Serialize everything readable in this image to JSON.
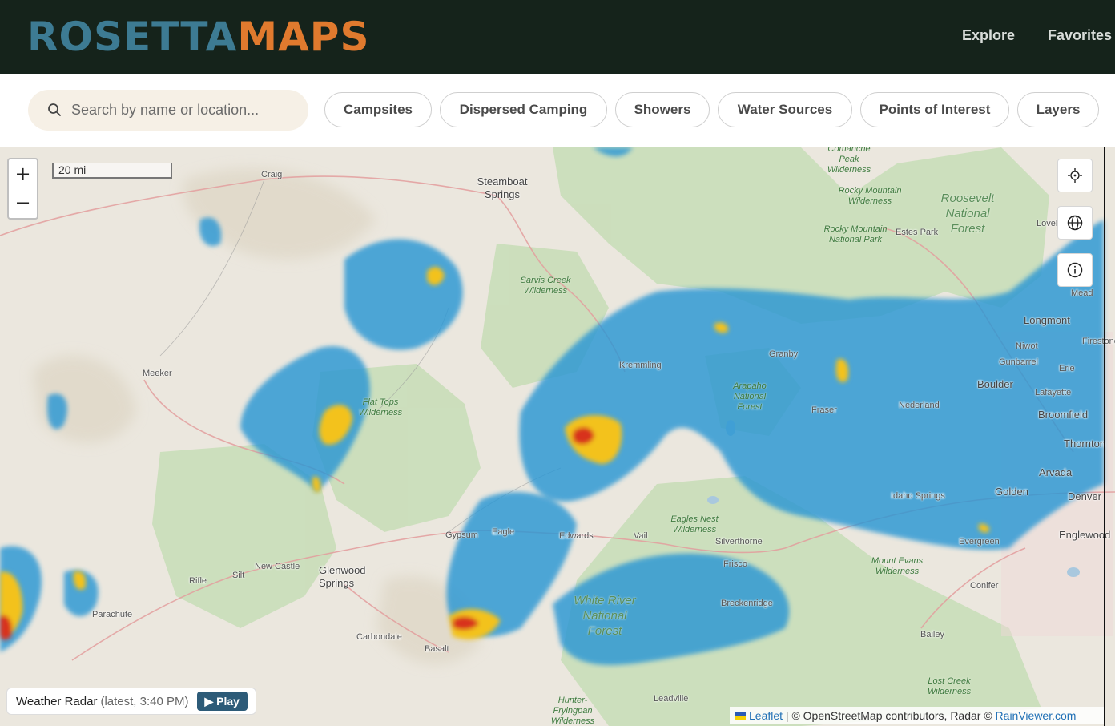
{
  "header": {
    "logo_part1": "ROSETTA",
    "logo_part2": "MAPS",
    "nav": [
      {
        "label": "Explore"
      },
      {
        "label": "Favorites"
      }
    ]
  },
  "filters": {
    "search_placeholder": "Search by name or location...",
    "chips": [
      {
        "label": "Campsites"
      },
      {
        "label": "Dispersed Camping"
      },
      {
        "label": "Showers"
      },
      {
        "label": "Water Sources"
      },
      {
        "label": "Points of Interest"
      },
      {
        "label": "Layers"
      }
    ]
  },
  "map": {
    "zoom_in": "+",
    "zoom_out": "−",
    "scale_label": "20 mi",
    "places": [
      "Craig",
      "Steamboat Springs",
      "Meeker",
      "Kremmling",
      "Granby",
      "Estes Park",
      "Longmont",
      "Firestone",
      "Niwot",
      "Gunbarrel",
      "Erie",
      "Boulder",
      "Lafayette",
      "Broomfield",
      "Thornton",
      "Arvada",
      "Golden",
      "Denver",
      "Englewood",
      "Nederland",
      "Fraser",
      "Idaho Springs",
      "Evergreen",
      "Conifer",
      "Bailey",
      "Silverthorne",
      "Frisco",
      "Breckenridge",
      "Vail",
      "Edwards",
      "Eagle",
      "Gypsum",
      "Glenwood Springs",
      "New Castle",
      "Silt",
      "Rifle",
      "Parachute",
      "Carbondale",
      "Basalt",
      "Leadville",
      "Mead",
      "Loveland"
    ],
    "parks": [
      "Comanche Peak Wilderness",
      "Rocky Mountain Wilderness",
      "Rocky Mountain National Park",
      "Roosevelt National Forest",
      "Sarvis Creek Wilderness",
      "Flat Tops Wilderness",
      "Arapaho National Forest",
      "Eagles Nest Wilderness",
      "White River National Forest",
      "Mount Evans Wilderness",
      "Lost Creek Wilderness",
      "Hunter-Fryingpan Wilderness"
    ],
    "radar_title": "Weather Radar",
    "radar_time": "(latest, 3:40 PM)",
    "play_label": "▶ Play",
    "attribution_leaflet": "Leaflet",
    "attribution_text": " | © OpenStreetMap contributors, Radar © ",
    "attribution_rainviewer": "RainViewer.com"
  },
  "colors": {
    "header_bg": "#15231b",
    "logo_blue": "#3d7b93",
    "logo_orange": "#e07a2e",
    "radar_blue": "#2a97d4",
    "radar_yellow": "#f3c21a",
    "radar_red": "#d8331f",
    "forest_green": "#c8ddb9"
  }
}
